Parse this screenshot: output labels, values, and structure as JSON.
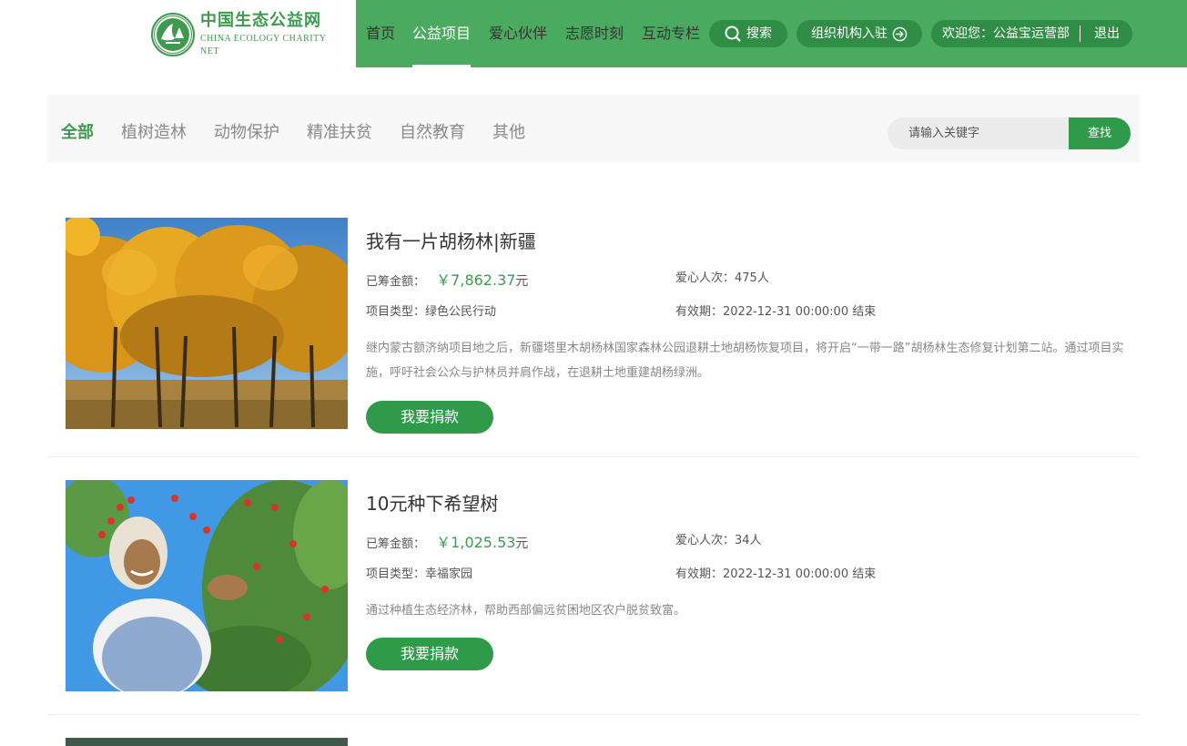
{
  "site": {
    "logo_cn": "中国生态公益网",
    "logo_en": "CHINA ECOLOGY CHARITY NET",
    "brand_color": "#4aaa5f"
  },
  "nav": {
    "items": [
      {
        "label": "首页",
        "active": false
      },
      {
        "label": "公益项目",
        "active": true
      },
      {
        "label": "爱心伙伴",
        "active": false
      },
      {
        "label": "志愿时刻",
        "active": false
      },
      {
        "label": "互动专栏",
        "active": false
      }
    ],
    "search_label": "搜索",
    "search_icon": "search-icon",
    "org_label": "组织机构入驻",
    "org_icon": "arrow-right-circle-icon",
    "welcome": "欢迎您：公益宝运营部",
    "logout": "退出"
  },
  "filter": {
    "categories": [
      {
        "label": "全部",
        "active": true
      },
      {
        "label": "植树造林",
        "active": false
      },
      {
        "label": "动物保护",
        "active": false
      },
      {
        "label": "精准扶贫",
        "active": false
      },
      {
        "label": "自然教育",
        "active": false
      },
      {
        "label": "其他",
        "active": false
      }
    ],
    "search_placeholder": "请输入关键字",
    "search_value": "",
    "search_button": "查找"
  },
  "labels": {
    "raised": "已筹金额：",
    "donors": "爱心人次：",
    "type": "项目类型：",
    "valid": "有效期：",
    "donate": "我要捐款",
    "currency": "￥",
    "unit": "元"
  },
  "projects": [
    {
      "title": "我有一片胡杨林|新疆",
      "amount": "7,862.37",
      "donors": "475人",
      "type": "绿色公民行动",
      "valid": "2022-12-31 00:00:00 结束",
      "desc": "继内蒙古额济纳项目地之后，新疆塔里木胡杨林国家森林公园退耕土地胡杨恢复项目，将开启“一带一路”胡杨林生态修复计划第二站。通过项目实施，呼吁社会公众与护林员并肩作战，在退耕土地重建胡杨绿洲。",
      "image": "autumn-poplar-forest-photo"
    },
    {
      "title": "10元种下希望树",
      "amount": "1,025.53",
      "donors": "34人",
      "type": "幸福家园",
      "valid": "2022-12-31 00:00:00 结束",
      "desc": "通过种植生态经济林，帮助西部偏远贫困地区农户脱贫致富。",
      "image": "woman-picking-goji-berries-photo"
    }
  ]
}
